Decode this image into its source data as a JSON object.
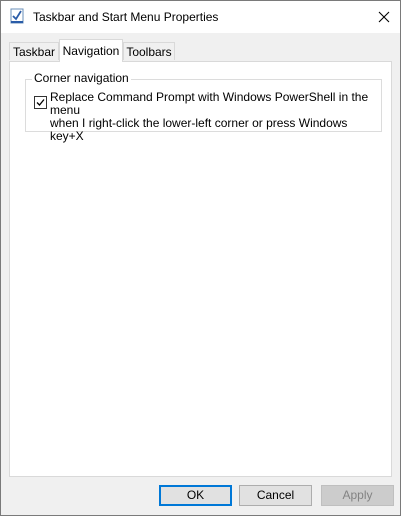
{
  "window": {
    "title": "Taskbar and Start Menu Properties"
  },
  "icons": {
    "app": "taskbar-properties-icon",
    "close": "close-icon",
    "check": "checkmark-icon"
  },
  "tabs": [
    {
      "label": "Taskbar",
      "active": false
    },
    {
      "label": "Navigation",
      "active": true
    },
    {
      "label": "Toolbars",
      "active": false
    }
  ],
  "corner_navigation": {
    "group_label": "Corner navigation",
    "powershell_option": {
      "checked": true,
      "line1": "Replace Command Prompt with Windows PowerShell in the menu",
      "line2": "when I right-click the lower-left corner or press Windows key+X"
    }
  },
  "buttons": {
    "ok": "OK",
    "cancel": "Cancel",
    "apply": "Apply"
  },
  "colors": {
    "accent": "#0078d7",
    "checkbox_check": "#000000"
  }
}
